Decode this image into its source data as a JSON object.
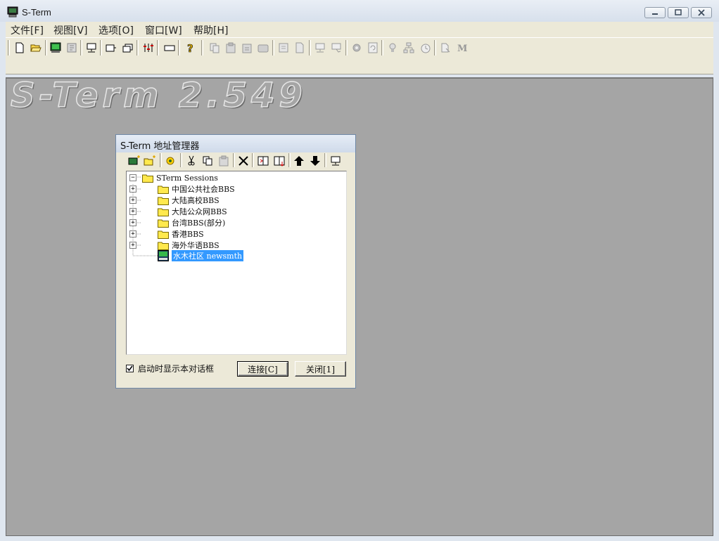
{
  "window": {
    "title": "S-Term"
  },
  "menu": [
    "文件[F]",
    "视图[V]",
    "选项[O]",
    "窗口[W]",
    "帮助[H]"
  ],
  "caption_buttons": [
    "minimize-icon",
    "restore-icon",
    "close-icon"
  ],
  "client": {
    "watermark": "S-Term 2.549"
  },
  "dialog": {
    "title": "S-Term 地址管理器",
    "tree": {
      "root": "STerm Sessions",
      "folders": [
        "中国公共社会BBS",
        "大陆高校BBS",
        "大陆公众网BBS",
        "台湾BBS(部分)",
        "香港BBS",
        "海外华语BBS"
      ],
      "selected_item": "水木社区 newsmth"
    },
    "checkbox": {
      "label": "启动时显示本对话框",
      "checked": true
    },
    "buttons": {
      "connect": "连接[C]",
      "close": "关闭[1]"
    }
  },
  "colors": {
    "selection": "#3399ff",
    "client_bg": "#a5a5a5",
    "chrome": "#ece9d8",
    "folder": "#ffe94d"
  }
}
